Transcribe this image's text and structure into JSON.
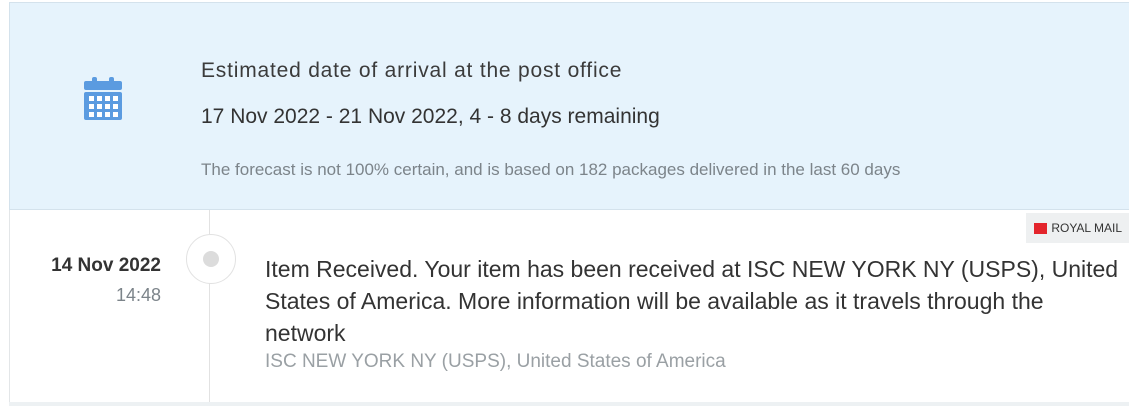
{
  "estimate": {
    "icon": "calendar-icon",
    "title": "Estimated date of arrival at the post office",
    "range": "17 Nov 2022 - 21 Nov 2022, 4 - 8 days remaining",
    "note": "The forecast is not 100% certain, and is based on 182 packages delivered in the last 60 days"
  },
  "events": [
    {
      "date": "14 Nov 2022",
      "time": "14:48",
      "description": "Item Received. Your item has been received at ISC NEW YORK NY (USPS), United States of America. More information will be available as it travels through the network",
      "location": "ISC NEW YORK NY (USPS), United States of America",
      "carrier": "ROYAL MAIL"
    }
  ],
  "colors": {
    "estimate_bg": "#e6f3fc",
    "icon": "#5b9be0",
    "carrier_logo": "#e3242b"
  }
}
